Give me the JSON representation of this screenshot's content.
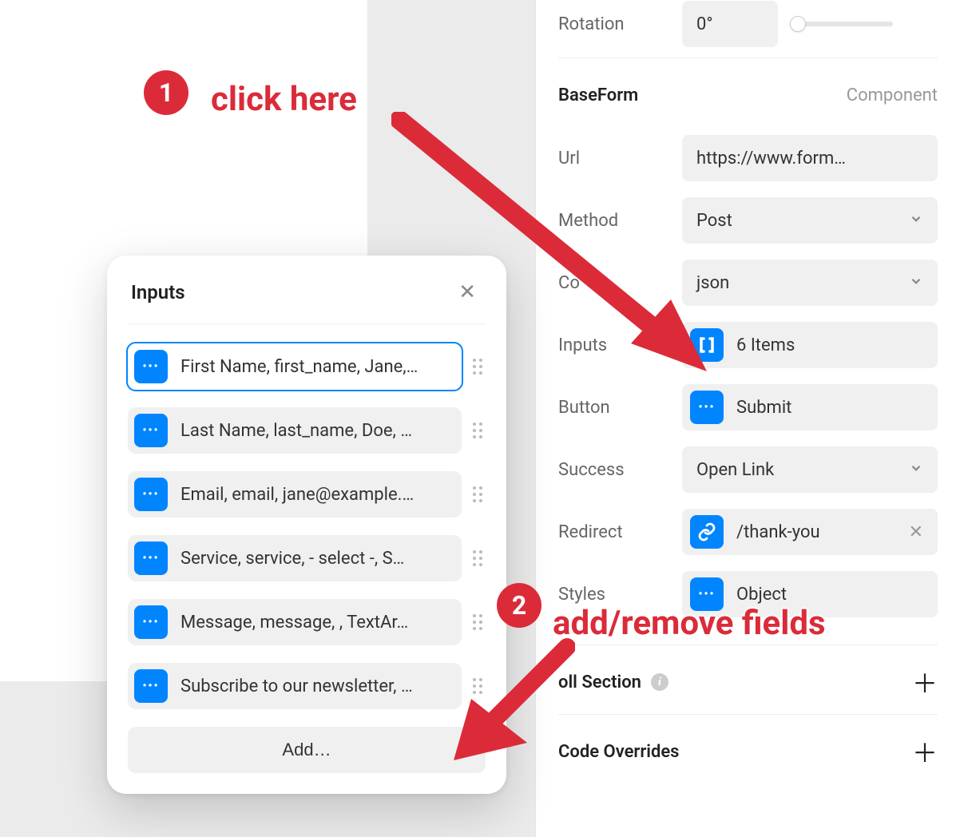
{
  "annotations": {
    "step1": {
      "badge": "1",
      "text": "click here"
    },
    "step2": {
      "badge": "2",
      "text": "add/remove fields"
    }
  },
  "panel": {
    "rotation": {
      "label": "Rotation",
      "value": "0°"
    },
    "baseform_section": {
      "title": "BaseForm",
      "sub": "Component"
    },
    "url": {
      "label": "Url",
      "value": "https://www.form…"
    },
    "method": {
      "label": "Method",
      "value": "Post"
    },
    "content_type": {
      "label": "Co",
      "value": "json"
    },
    "inputs": {
      "label": "Inputs",
      "value": "6 Items"
    },
    "button": {
      "label": "Button",
      "value": "Submit"
    },
    "success": {
      "label": "Success",
      "value": "Open Link"
    },
    "redirect": {
      "label": "Redirect",
      "value": "/thank-you"
    },
    "styles": {
      "label": "Styles",
      "value": "Object"
    },
    "scroll_section": {
      "title": "oll Section"
    },
    "code_overrides": {
      "title": "Code Overrides"
    }
  },
  "popup": {
    "title": "Inputs",
    "items": [
      "First Name, first_name, Jane,…",
      "Last Name, last_name, Doe, …",
      "Email, email, jane@example.…",
      "Service, service, - select -, S…",
      "Message, message, , TextAr…",
      "Subscribe to our newsletter, …"
    ],
    "add_label": "Add…"
  }
}
